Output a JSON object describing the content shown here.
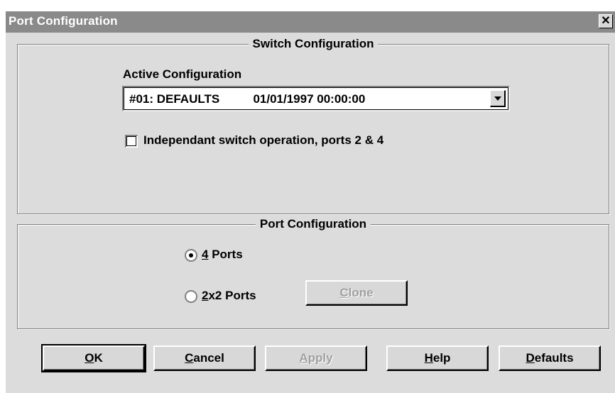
{
  "window": {
    "title": "Port Configuration",
    "close_glyph": "✕"
  },
  "switch_group": {
    "legend": "Switch Configuration",
    "active_label": "Active Configuration",
    "active_value": "#01: DEFAULTS          01/01/1997 00:00:00",
    "independent_checkbox": {
      "label": "Independant switch operation, ports 2 & 4",
      "checked": false
    }
  },
  "port_group": {
    "legend": "Port Configuration",
    "options": [
      {
        "mnemonic": "4",
        "rest": " Ports",
        "selected": true
      },
      {
        "mnemonic": "2",
        "rest": "x2 Ports",
        "selected": false
      }
    ],
    "clone_button": {
      "mnemonic": "C",
      "rest": "lone",
      "enabled": false
    }
  },
  "buttons": [
    {
      "mnemonic": "O",
      "rest": "K",
      "enabled": true,
      "default": true
    },
    {
      "mnemonic": "C",
      "rest": "ancel",
      "enabled": true
    },
    {
      "mnemonic": "A",
      "rest": "pply",
      "enabled": false
    },
    {
      "mnemonic": "H",
      "rest": "elp",
      "enabled": true
    },
    {
      "mnemonic": "D",
      "rest": "efaults",
      "enabled": true
    }
  ],
  "colors": {
    "titlebar": "#8a8a8a",
    "dialog_bg": "#dcdcdc",
    "disabled_text": "#a0a0a0"
  }
}
